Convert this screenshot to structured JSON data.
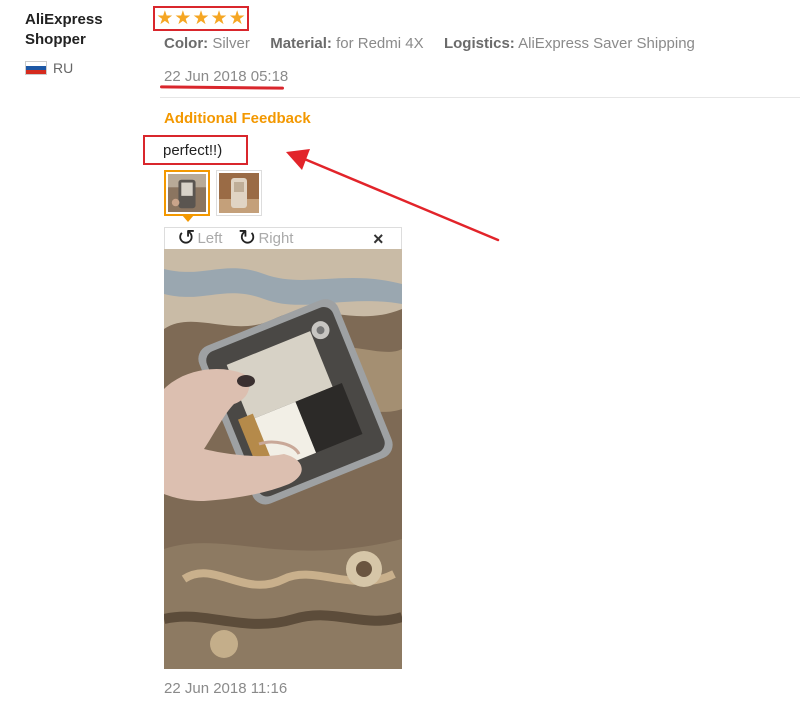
{
  "reviewer": {
    "name": "AliExpress Shopper",
    "country": "RU"
  },
  "rating": {
    "stars": 5,
    "star_glyphs": [
      "★",
      "★",
      "★",
      "★",
      "★"
    ],
    "star_color": "#f5a623"
  },
  "attributes": [
    {
      "key": "Color:",
      "value": "Silver"
    },
    {
      "key": "Material:",
      "value": "for Redmi 4X"
    },
    {
      "key": "Logistics:",
      "value": "AliExpress Saver Shipping"
    }
  ],
  "review_date": "22 Jun 2018 05:18",
  "additional_feedback": {
    "heading": "Additional Feedback",
    "text": "perfect!!)",
    "date": "22 Jun 2018 11:16"
  },
  "viewer": {
    "rotate_left_label": "Left",
    "rotate_right_label": "Right",
    "close_label": "×"
  },
  "colors": {
    "highlight_red": "#d9262c",
    "accent_orange": "#f39800",
    "muted_text": "#8a8a8a"
  }
}
